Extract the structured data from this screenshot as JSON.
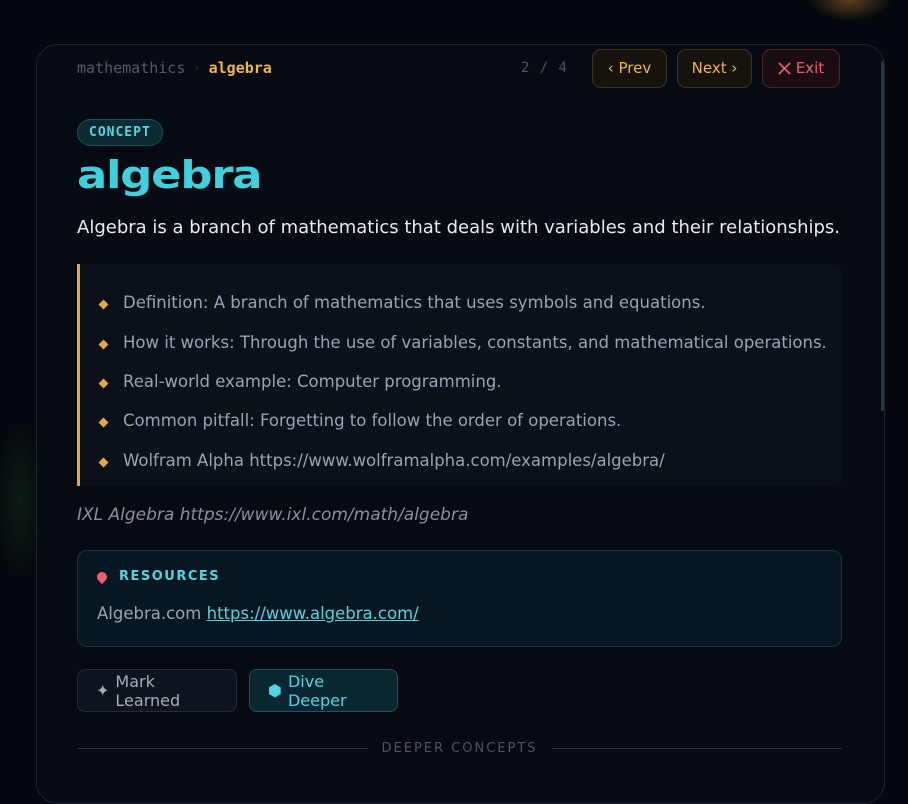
{
  "breadcrumb": {
    "root": "mathemathics",
    "separator": "›",
    "current": "algebra"
  },
  "pagination": {
    "count": "2 / 4",
    "prev_label": "‹ Prev",
    "next_label": "Next ›",
    "exit_label": "Exit"
  },
  "concept": {
    "tag": "CONCEPT",
    "title": "algebra",
    "summary": "Algebra is a branch of mathematics that deals with variables and their relationships.",
    "bullets": [
      "Definition: A branch of mathematics that uses symbols and equations.",
      "How it works: Through the use of variables, constants, and mathematical operations.",
      "Real-world example: Computer programming.",
      "Common pitfall: Forgetting to follow the order of operations.",
      "Wolfram Alpha https://www.wolframalpha.com/examples/algebra/"
    ],
    "source_note": "IXL Algebra https://www.ixl.com/math/algebra"
  },
  "resources": {
    "heading": "RESOURCES",
    "icon": "pin-icon",
    "item_label": "Algebra.com",
    "item_link": "https://www.algebra.com/"
  },
  "actions": {
    "mark_learned": "Mark Learned",
    "dive_deeper": "Dive Deeper"
  },
  "section": {
    "deeper_concepts": "DEEPER CONCEPTS"
  },
  "colors": {
    "accent_cyan": "#3fd0dc",
    "accent_amber": "#f2b44b",
    "danger": "#ef5c70"
  }
}
